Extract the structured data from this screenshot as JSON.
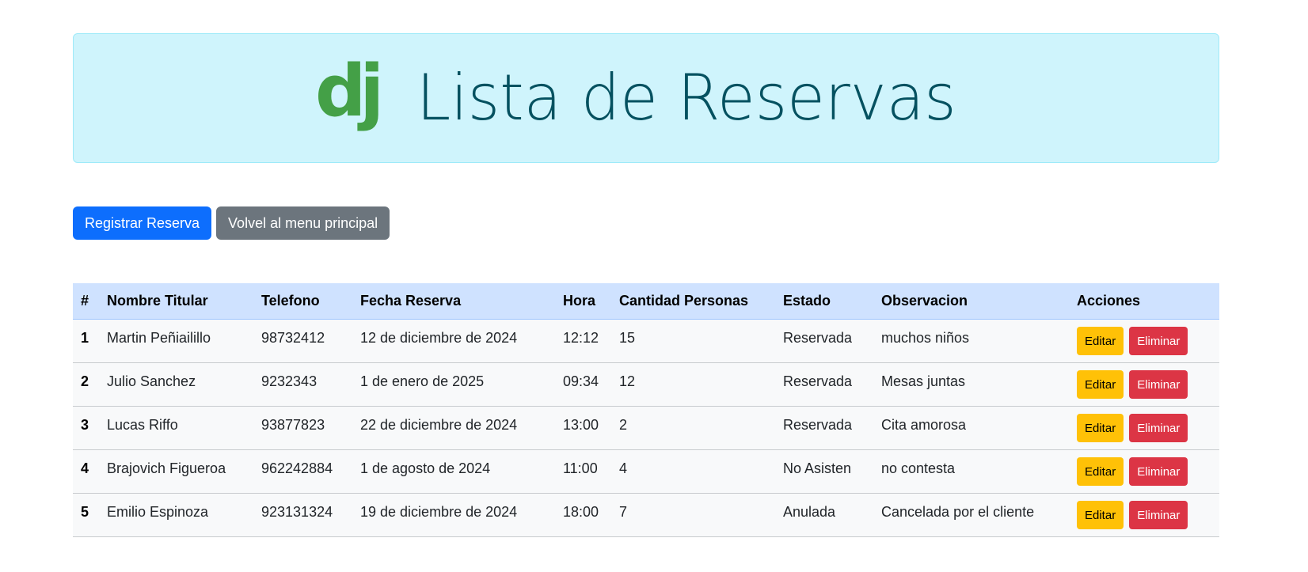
{
  "banner": {
    "title": "Lista de Reservas",
    "logo_text": "dj",
    "logo_icon": "django-logo",
    "background_color": "#cff4fc",
    "title_color": "#055160",
    "logo_color": "#44a047"
  },
  "toolbar": {
    "register_label": "Registrar Reserva",
    "back_label": "Volvel al menu principal"
  },
  "table": {
    "headers": {
      "index": "#",
      "nombre": "Nombre Titular",
      "telefono": "Telefono",
      "fecha": "Fecha Reserva",
      "hora": "Hora",
      "cantidad": "Cantidad Personas",
      "estado": "Estado",
      "observacion": "Observacion",
      "acciones": "Acciones"
    },
    "rows": [
      {
        "index": "1",
        "nombre": "Martin Peñiailillo",
        "telefono": "98732412",
        "fecha": "12 de diciembre de 2024",
        "hora": "12:12",
        "cantidad": "15",
        "estado": "Reservada",
        "observacion": "muchos niños",
        "edit_label": "Editar",
        "delete_label": "Eliminar"
      },
      {
        "index": "2",
        "nombre": "Julio Sanchez",
        "telefono": "9232343",
        "fecha": "1 de enero de 2025",
        "hora": "09:34",
        "cantidad": "12",
        "estado": "Reservada",
        "observacion": "Mesas juntas",
        "edit_label": "Editar",
        "delete_label": "Eliminar"
      },
      {
        "index": "3",
        "nombre": "Lucas Riffo",
        "telefono": "93877823",
        "fecha": "22 de diciembre de 2024",
        "hora": "13:00",
        "cantidad": "2",
        "estado": "Reservada",
        "observacion": "Cita amorosa",
        "edit_label": "Editar",
        "delete_label": "Eliminar"
      },
      {
        "index": "4",
        "nombre": "Brajovich Figueroa",
        "telefono": "962242884",
        "fecha": "1 de agosto de 2024",
        "hora": "11:00",
        "cantidad": "4",
        "estado": "No Asisten",
        "observacion": "no contesta",
        "edit_label": "Editar",
        "delete_label": "Eliminar"
      },
      {
        "index": "5",
        "nombre": "Emilio Espinoza",
        "telefono": "923131324",
        "fecha": "19 de diciembre de 2024",
        "hora": "18:00",
        "cantidad": "7",
        "estado": "Anulada",
        "observacion": "Cancelada por el cliente",
        "edit_label": "Editar",
        "delete_label": "Eliminar"
      }
    ]
  }
}
